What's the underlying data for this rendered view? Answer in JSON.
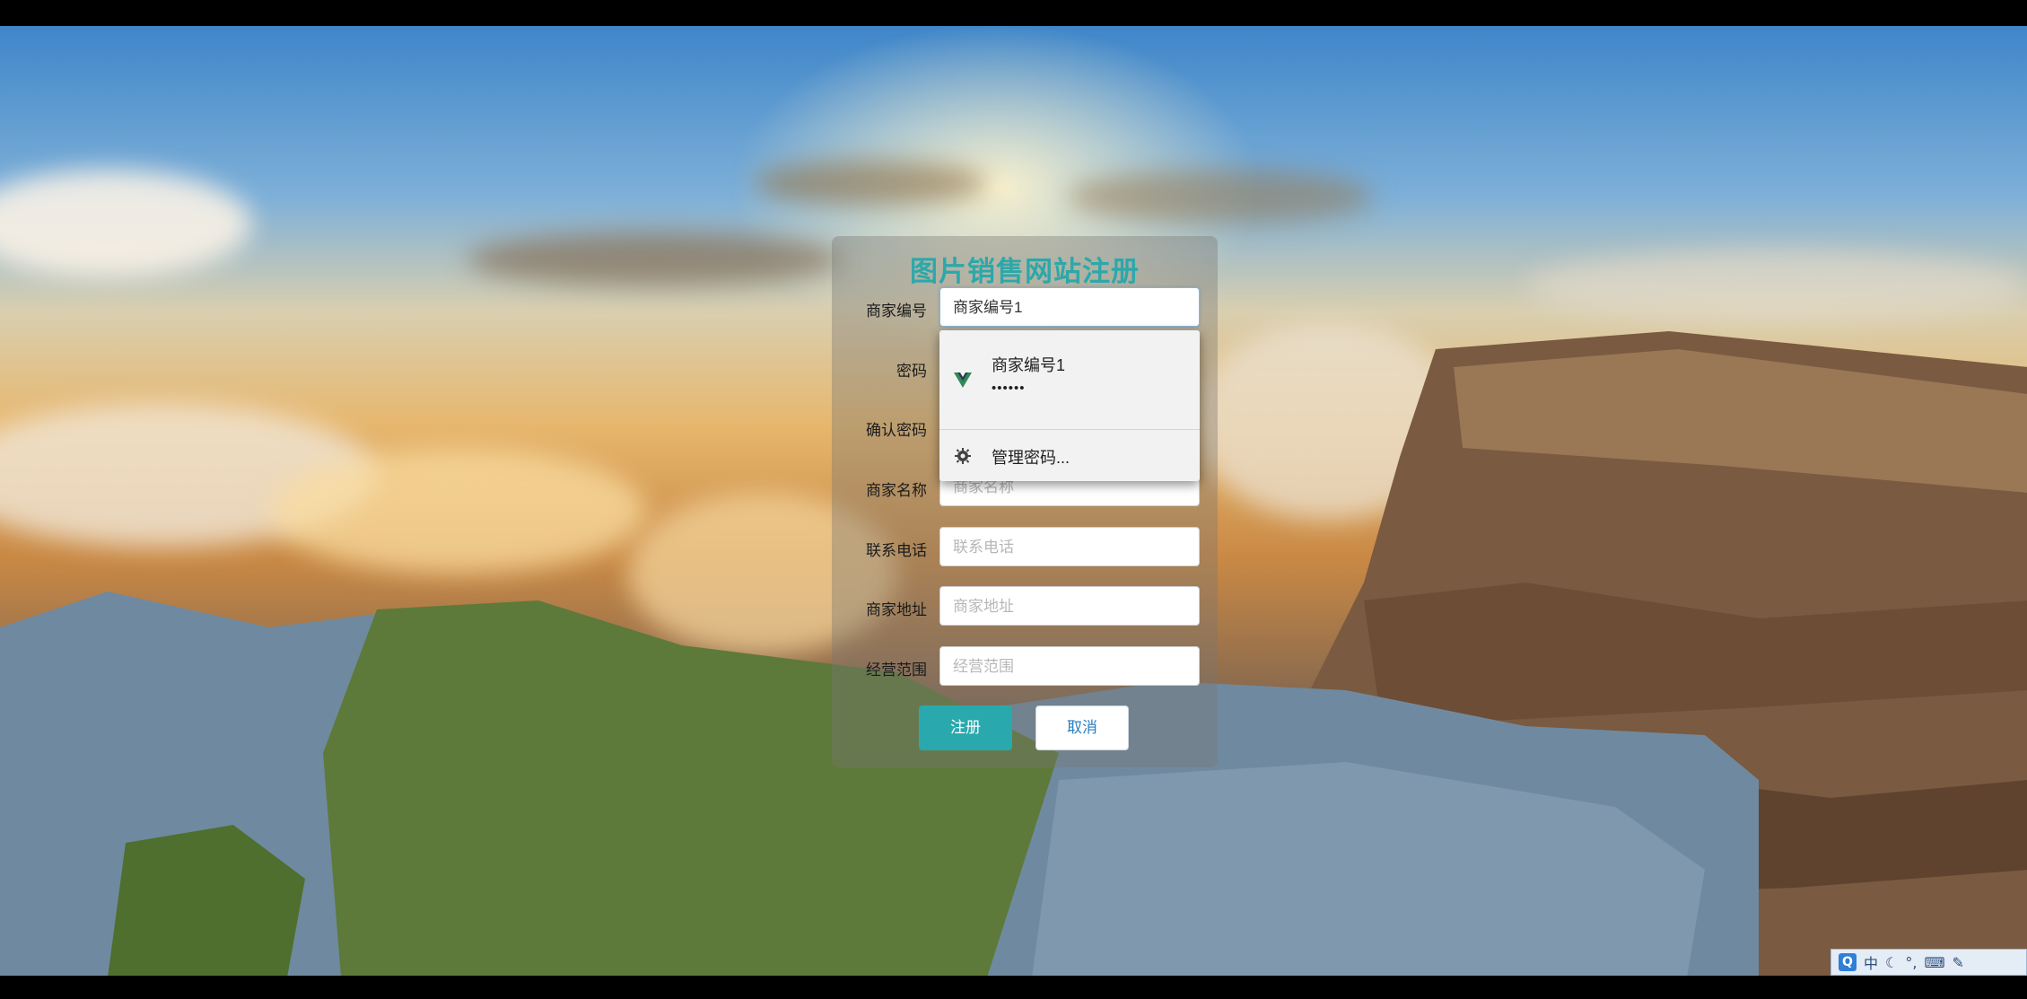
{
  "form": {
    "title": "图片销售网站注册",
    "fields": [
      {
        "label": "商家编号",
        "value": "商家编号1",
        "placeholder": ""
      },
      {
        "label": "密码",
        "value": "",
        "placeholder": ""
      },
      {
        "label": "确认密码",
        "value": "",
        "placeholder": ""
      },
      {
        "label": "商家名称",
        "value": "",
        "placeholder": "商家名称"
      },
      {
        "label": "联系电话",
        "value": "",
        "placeholder": "联系电话"
      },
      {
        "label": "商家地址",
        "value": "",
        "placeholder": "商家地址"
      },
      {
        "label": "经营范围",
        "value": "",
        "placeholder": "经营范围"
      }
    ],
    "register_label": "注册",
    "cancel_label": "取消"
  },
  "autofill": {
    "username": "商家编号1",
    "password_mask": "••••••",
    "manage_label": "管理密码...",
    "brand_icon": "vue-logo-icon",
    "manage_icon": "gear-icon"
  },
  "tray": {
    "ime": "中",
    "icons": [
      "qq-icon",
      "moon-icon",
      "punctuation-icon",
      "keyboard-icon",
      "settings-icon"
    ]
  },
  "colors": {
    "title": "#2ca8aa",
    "primary_button": "#29a9ad"
  }
}
